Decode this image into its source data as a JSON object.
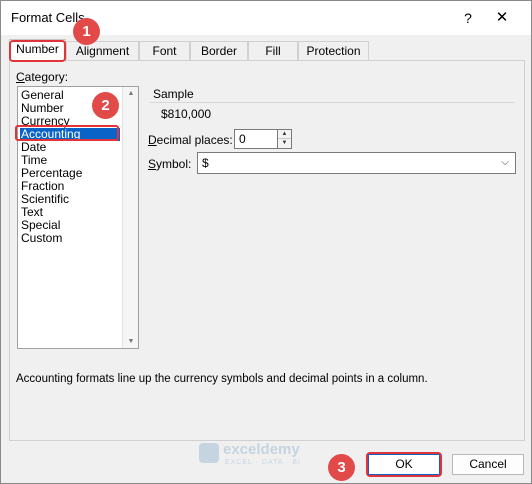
{
  "window": {
    "title": "Format Cells",
    "help_glyph": "?",
    "close_glyph": "✕"
  },
  "tabs": [
    {
      "label": "Number",
      "active": true
    },
    {
      "label": "Alignment",
      "active": false
    },
    {
      "label": "Font",
      "active": false
    },
    {
      "label": "Border",
      "active": false
    },
    {
      "label": "Fill",
      "active": false
    },
    {
      "label": "Protection",
      "active": false
    }
  ],
  "category": {
    "label_first": "C",
    "label_rest": "ategory:",
    "items": [
      "General",
      "Number",
      "Currency",
      "Accounting",
      "Date",
      "Time",
      "Percentage",
      "Fraction",
      "Scientific",
      "Text",
      "Special",
      "Custom"
    ],
    "selected": "Accounting"
  },
  "sample": {
    "label": "Sample",
    "value": "$810,000"
  },
  "decimal_places": {
    "label_first": "D",
    "label_rest": "ecimal places:",
    "value": "0"
  },
  "symbol": {
    "label_first": "S",
    "label_rest": "ymbol:",
    "value": "$"
  },
  "description": "Accounting formats line up the currency symbols and decimal points in a column.",
  "watermark": {
    "name": "exceldemy",
    "tagline": "EXCEL · DATA · BI"
  },
  "buttons": {
    "ok": "OK",
    "cancel": "Cancel"
  },
  "annotations": {
    "step1": "1",
    "step2": "2",
    "step3": "3",
    "color": "#e24a4a"
  }
}
